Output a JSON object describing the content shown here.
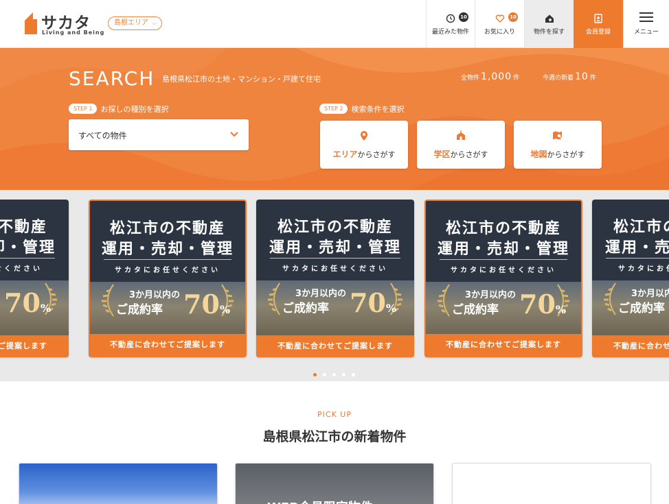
{
  "header": {
    "logo_text": "サカタ",
    "logo_sub": "Living and Being",
    "area_label": "島根エリア",
    "nav": [
      {
        "label": "最近みた物件",
        "badge": "10",
        "icon": "clock-icon"
      },
      {
        "label": "お気に入り",
        "badge": "10",
        "icon": "heart-icon"
      },
      {
        "label": "物件を探す",
        "icon": "house-search-icon"
      },
      {
        "label": "会員登録",
        "icon": "member-card-icon"
      },
      {
        "label": "メニュー",
        "icon": "hamburger-icon"
      }
    ]
  },
  "search": {
    "title": "SEARCH",
    "subtitle": "島根県松江市の土地・マンション・戸建て住宅",
    "total_prefix": "全物件",
    "total_count": "1,000",
    "total_suffix": "件",
    "new_prefix": "今週の新着",
    "new_count": "10",
    "new_suffix": "件",
    "step1_tag": "STEP 1",
    "step1_text": "お探しの種別を選択",
    "type_select_value": "すべての物件",
    "step2_tag": "STEP 2",
    "step2_text": "検索条件を選択",
    "conditions": [
      {
        "highlight": "エリア",
        "rest": "からさがす",
        "icon": "map-pin-icon"
      },
      {
        "highlight": "学区",
        "rest": "からさがす",
        "icon": "school-icon"
      },
      {
        "highlight": "地図",
        "rest": "からさがす",
        "icon": "map-search-icon"
      }
    ]
  },
  "banner": {
    "line1": "松江市の不動産",
    "line2": "運用・売却・管理",
    "line3": "サカタにお任せください",
    "badge1": "3か月以内の",
    "badge2": "ご成約率",
    "percent": "70",
    "percent_unit": "%",
    "footer": "不動産に合わせてご提案します"
  },
  "carousel": {
    "slide_count": 5,
    "active_index": 0
  },
  "pickup": {
    "label_en": "PICK UP",
    "title": "島根県松江市の新着物件",
    "card2_label": "WEB会員限定物件"
  },
  "colors": {
    "accent": "#ee7a2e",
    "dark": "#333333"
  }
}
